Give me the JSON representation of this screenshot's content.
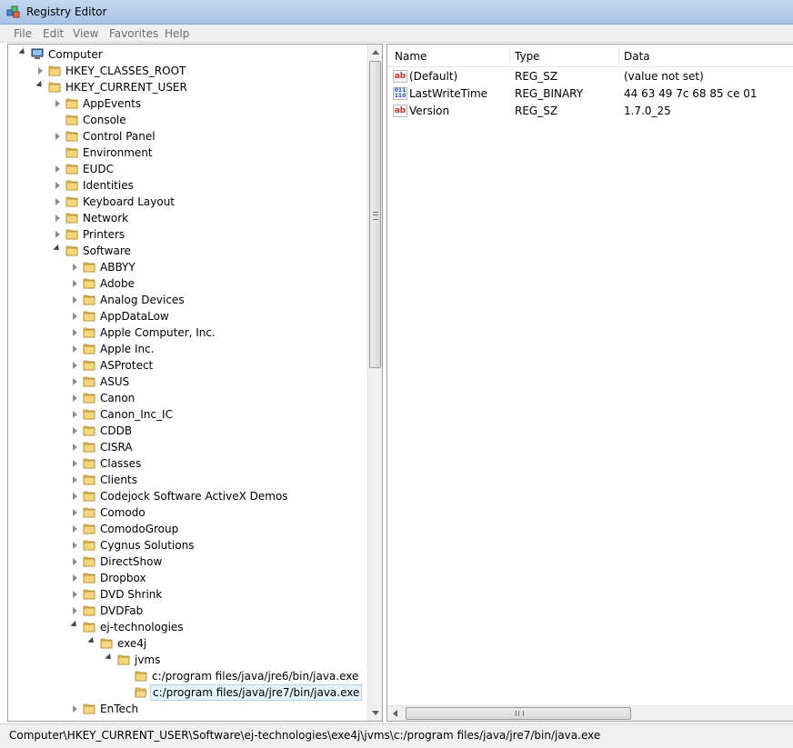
{
  "window": {
    "title": "Registry Editor"
  },
  "menu": [
    "File",
    "Edit",
    "View",
    "Favorites",
    "Help"
  ],
  "tree": [
    {
      "label": "Computer",
      "depth": 0,
      "state": "expanded",
      "icon": "computer-icon"
    },
    {
      "label": "HKEY_CLASSES_ROOT",
      "depth": 1,
      "state": "collapsed",
      "icon": "folder-icon"
    },
    {
      "label": "HKEY_CURRENT_USER",
      "depth": 1,
      "state": "expanded",
      "icon": "folder-icon"
    },
    {
      "label": "AppEvents",
      "depth": 2,
      "state": "collapsed",
      "icon": "folder-icon"
    },
    {
      "label": "Console",
      "depth": 2,
      "state": "none",
      "icon": "folder-icon"
    },
    {
      "label": "Control Panel",
      "depth": 2,
      "state": "collapsed",
      "icon": "folder-icon"
    },
    {
      "label": "Environment",
      "depth": 2,
      "state": "none",
      "icon": "folder-icon"
    },
    {
      "label": "EUDC",
      "depth": 2,
      "state": "collapsed",
      "icon": "folder-icon"
    },
    {
      "label": "Identities",
      "depth": 2,
      "state": "collapsed",
      "icon": "folder-icon"
    },
    {
      "label": "Keyboard Layout",
      "depth": 2,
      "state": "collapsed",
      "icon": "folder-icon"
    },
    {
      "label": "Network",
      "depth": 2,
      "state": "collapsed",
      "icon": "folder-icon"
    },
    {
      "label": "Printers",
      "depth": 2,
      "state": "collapsed",
      "icon": "folder-icon"
    },
    {
      "label": "Software",
      "depth": 2,
      "state": "expanded",
      "icon": "folder-icon"
    },
    {
      "label": "ABBYY",
      "depth": 3,
      "state": "collapsed",
      "icon": "folder-icon"
    },
    {
      "label": "Adobe",
      "depth": 3,
      "state": "collapsed",
      "icon": "folder-icon"
    },
    {
      "label": "Analog Devices",
      "depth": 3,
      "state": "collapsed",
      "icon": "folder-icon"
    },
    {
      "label": "AppDataLow",
      "depth": 3,
      "state": "collapsed",
      "icon": "folder-icon"
    },
    {
      "label": "Apple Computer, Inc.",
      "depth": 3,
      "state": "collapsed",
      "icon": "folder-icon"
    },
    {
      "label": "Apple Inc.",
      "depth": 3,
      "state": "collapsed",
      "icon": "folder-icon"
    },
    {
      "label": "ASProtect",
      "depth": 3,
      "state": "collapsed",
      "icon": "folder-icon"
    },
    {
      "label": "ASUS",
      "depth": 3,
      "state": "collapsed",
      "icon": "folder-icon"
    },
    {
      "label": "Canon",
      "depth": 3,
      "state": "collapsed",
      "icon": "folder-icon"
    },
    {
      "label": "Canon_Inc_IC",
      "depth": 3,
      "state": "collapsed",
      "icon": "folder-icon"
    },
    {
      "label": "CDDB",
      "depth": 3,
      "state": "collapsed",
      "icon": "folder-icon"
    },
    {
      "label": "CISRA",
      "depth": 3,
      "state": "collapsed",
      "icon": "folder-icon"
    },
    {
      "label": "Classes",
      "depth": 3,
      "state": "collapsed",
      "icon": "folder-icon"
    },
    {
      "label": "Clients",
      "depth": 3,
      "state": "collapsed",
      "icon": "folder-icon"
    },
    {
      "label": "Codejock Software ActiveX Demos",
      "depth": 3,
      "state": "collapsed",
      "icon": "folder-icon"
    },
    {
      "label": "Comodo",
      "depth": 3,
      "state": "collapsed",
      "icon": "folder-icon"
    },
    {
      "label": "ComodoGroup",
      "depth": 3,
      "state": "collapsed",
      "icon": "folder-icon"
    },
    {
      "label": "Cygnus Solutions",
      "depth": 3,
      "state": "collapsed",
      "icon": "folder-icon"
    },
    {
      "label": "DirectShow",
      "depth": 3,
      "state": "collapsed",
      "icon": "folder-icon"
    },
    {
      "label": "Dropbox",
      "depth": 3,
      "state": "collapsed",
      "icon": "folder-icon"
    },
    {
      "label": "DVD Shrink",
      "depth": 3,
      "state": "collapsed",
      "icon": "folder-icon"
    },
    {
      "label": "DVDFab",
      "depth": 3,
      "state": "collapsed",
      "icon": "folder-icon"
    },
    {
      "label": "ej-technologies",
      "depth": 3,
      "state": "expanded",
      "icon": "folder-icon"
    },
    {
      "label": "exe4j",
      "depth": 4,
      "state": "expanded",
      "icon": "folder-icon"
    },
    {
      "label": "jvms",
      "depth": 5,
      "state": "expanded",
      "icon": "folder-icon"
    },
    {
      "label": "c:/program files/java/jre6/bin/java.exe",
      "depth": 6,
      "state": "none",
      "icon": "folder-icon"
    },
    {
      "label": "c:/program files/java/jre7/bin/java.exe",
      "depth": 6,
      "state": "none",
      "icon": "folder-open-icon",
      "selected": true
    },
    {
      "label": "EnTech",
      "depth": 3,
      "state": "collapsed",
      "icon": "folder-icon"
    }
  ],
  "columns": [
    "Name",
    "Type",
    "Data"
  ],
  "values": [
    {
      "name": "(Default)",
      "type": "REG_SZ",
      "data": "(value not set)",
      "icon": "string-value-icon"
    },
    {
      "name": "LastWriteTime",
      "type": "REG_BINARY",
      "data": "44 63 49 7c 68 85 ce 01",
      "icon": "binary-value-icon"
    },
    {
      "name": "Version",
      "type": "REG_SZ",
      "data": "1.7.0_25",
      "icon": "string-value-icon"
    }
  ],
  "status": {
    "path": "Computer\\HKEY_CURRENT_USER\\Software\\ej-technologies\\exe4j\\jvms\\c:/program files/java/jre7/bin/java.exe"
  },
  "colors": {
    "folder": "#e8c35a",
    "selection": "#e5f3fb",
    "titlebar": "#b5cdec"
  }
}
